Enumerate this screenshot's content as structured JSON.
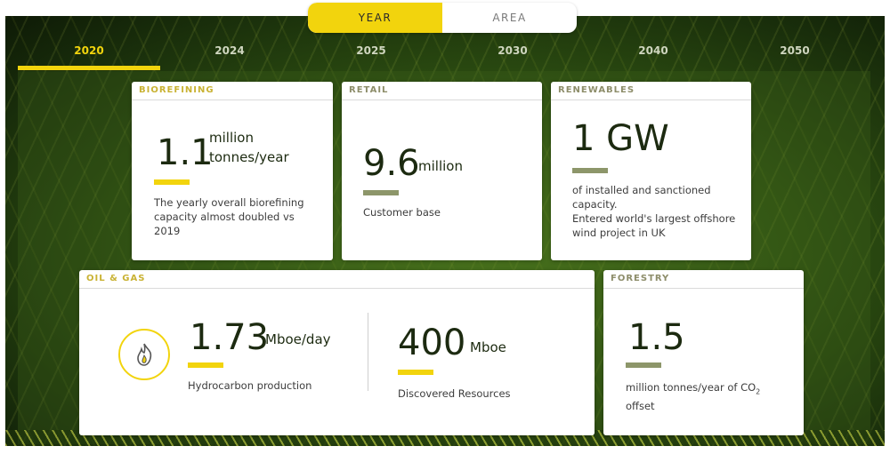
{
  "toggle": {
    "year": "YEAR",
    "area": "AREA"
  },
  "timeline": {
    "years": [
      "2020",
      "2024",
      "2025",
      "2030",
      "2040",
      "2050"
    ],
    "selected": "2020"
  },
  "colors": {
    "accent_yellow": "#f2d40d",
    "accent_olive": "#8d966a"
  },
  "cards": {
    "biorefining": {
      "title": "BIOREFINING",
      "value": "1.1",
      "unit_line1": "million",
      "unit_line2": "tonnes/year",
      "desc": "The yearly overall biorefining capacity almost doubled vs 2019"
    },
    "retail": {
      "title": "RETAIL",
      "value": "9.6",
      "unit": "million",
      "desc": "Customer base"
    },
    "renewables": {
      "title": "RENEWABLES",
      "value": "1 GW",
      "desc1": "of installed and sanctioned capacity.",
      "desc2": "Entered world's largest offshore wind project in UK"
    },
    "oil_gas": {
      "title": "OIL & GAS",
      "icon": "flame-icon",
      "production_value": "1.73",
      "production_unit": "Mboe/day",
      "production_desc": "Hydrocarbon production",
      "resources_value": "400",
      "resources_unit": "Mboe",
      "resources_desc": "Discovered Resources"
    },
    "forestry": {
      "title": "FORESTRY",
      "value": "1.5",
      "desc_main": "million tonnes/year of CO",
      "desc_sub": "2",
      "desc_end": "offset"
    }
  }
}
